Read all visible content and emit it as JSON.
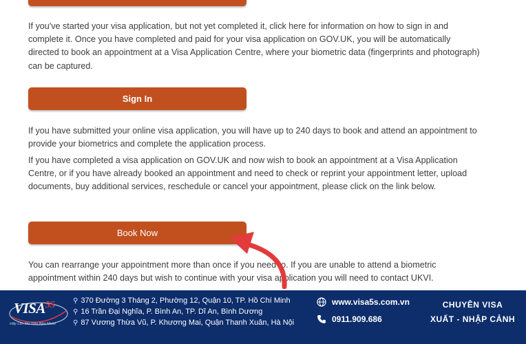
{
  "colors": {
    "accent": "#c2501f",
    "footer_bg": "#0d2d6b",
    "arrow": "#e23b3b"
  },
  "paragraphs": {
    "p1": "If you've started your visa application, but not yet completed it, click here for information on how to sign in and complete it. Once you have completed and paid for your visa application on GOV.UK, you will be automatically directed to book an appointment at a Visa Application Centre, where your biometric data (fingerprints and photograph) can be captured.",
    "p2": "If you have submitted your online visa application, you will have up to 240 days to book and attend an appointment to provide your biometrics and complete the application process.",
    "p3": "If you have completed a visa application on GOV.UK and now wish to book an appointment at a Visa Application Centre, or if you have already booked an appointment and need to check or reprint your appointment letter, upload documents, buy additional services, reschedule or cancel your appointment, please click on the link below.",
    "p4": "You can rearrange your appointment more than once if you need to. If you are unable to attend a biometric appointment within 240 days but wish to continue with your visa application you will need to contact UKVI."
  },
  "buttons": {
    "sign_in": "Sign In",
    "book_now": "Book Now"
  },
  "footer": {
    "logo_text": "VISA",
    "logo_num": "5S",
    "logo_slogan": "Hãy Lên Đủ Tiền Bận Mười",
    "addresses": [
      "370 Đường 3 Tháng 2, Phường 12, Quận 10, TP. Hồ Chí Minh",
      "16 Trần Đại Nghĩa, P. Bình An, TP. Dĩ An, Bình Dương",
      "87 Vương Thừa Vũ, P. Khương Mai, Quận Thanh Xuân, Hà Nội"
    ],
    "website": "www.visa5s.com.vn",
    "phone": "0911.909.686",
    "tagline_1": "CHUYÊN VISA",
    "tagline_2": "XUẤT - NHẬP CẢNH",
    "icons": [
      "location-pin-icon",
      "globe-icon",
      "phone-icon"
    ]
  }
}
